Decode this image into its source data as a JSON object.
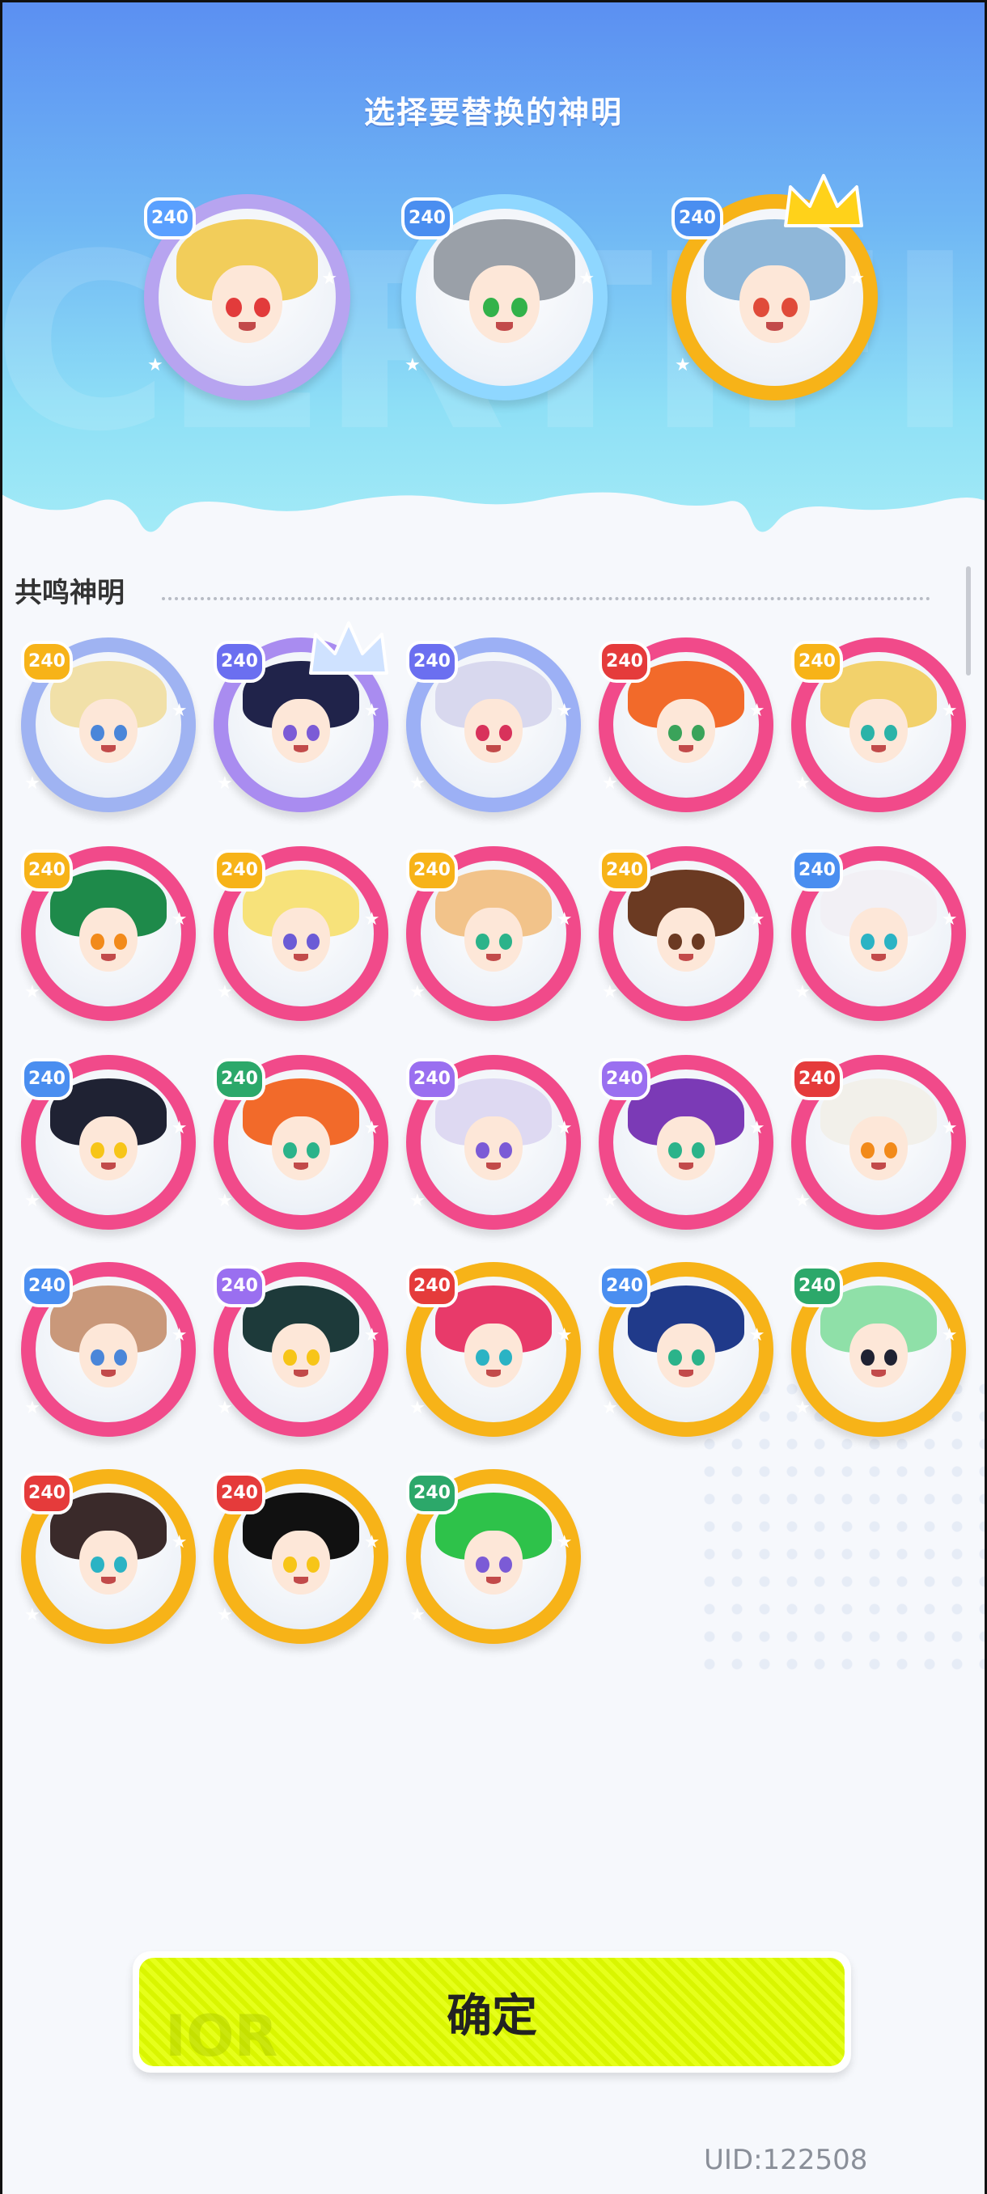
{
  "header": {
    "title": "选择要替换的神明",
    "bg_text": "CERTIFIE"
  },
  "selected": [
    {
      "level": "240",
      "ring": "#b7a4f0",
      "badge": "#5aa0ff",
      "hair": "#f2cd5a",
      "eye": "#e23b3b",
      "crown": false
    },
    {
      "level": "240",
      "ring": "#8fd7ff",
      "badge": "#4a8ef0",
      "hair": "#9aa0a8",
      "eye": "#32b24a",
      "crown": false
    },
    {
      "level": "240",
      "ring": "#f7b318",
      "badge": "#4a8ef0",
      "hair": "#8fb7d9",
      "eye": "#e04b3a",
      "crown": true
    }
  ],
  "section": {
    "label": "共鸣神明"
  },
  "gods": [
    {
      "level": "240",
      "ring": "#9fb3f2",
      "badge": "#f7b318",
      "hair": "#f1e0a8",
      "eye": "#4a86d9",
      "crown": false
    },
    {
      "level": "240",
      "ring": "#a98cf0",
      "badge": "#6b6ff0",
      "hair": "#20234a",
      "eye": "#7b5bd6",
      "crown": true
    },
    {
      "level": "240",
      "ring": "#9cb0f5",
      "badge": "#6b6ff0",
      "hair": "#d8d8ee",
      "eye": "#d8325b",
      "crown": false
    },
    {
      "level": "240",
      "ring": "#f14a8a",
      "badge": "#e53b3b",
      "hair": "#f26a2a",
      "eye": "#3aa35a",
      "crown": false
    },
    {
      "level": "240",
      "ring": "#f14a8a",
      "badge": "#f7b318",
      "hair": "#f2d16b",
      "eye": "#2bb3a8",
      "crown": false
    },
    {
      "level": "240",
      "ring": "#f14a8a",
      "badge": "#f7b318",
      "hair": "#1e8a4a",
      "eye": "#f28a1a",
      "crown": false
    },
    {
      "level": "240",
      "ring": "#f14a8a",
      "badge": "#f7b318",
      "hair": "#f7e27a",
      "eye": "#6b5bd6",
      "crown": false
    },
    {
      "level": "240",
      "ring": "#f14a8a",
      "badge": "#f7b318",
      "hair": "#f2c38a",
      "eye": "#2bb38a",
      "crown": false
    },
    {
      "level": "240",
      "ring": "#f14a8a",
      "badge": "#f7b318",
      "hair": "#6b3a22",
      "eye": "#6b3a22",
      "crown": false
    },
    {
      "level": "240",
      "ring": "#f14a8a",
      "badge": "#4a8ef0",
      "hair": "#f2f0f5",
      "eye": "#2bb3c4",
      "crown": false
    },
    {
      "level": "240",
      "ring": "#f14a8a",
      "badge": "#4a8ef0",
      "hair": "#1f2233",
      "eye": "#f7c518",
      "crown": false
    },
    {
      "level": "240",
      "ring": "#f14a8a",
      "badge": "#2ca86a",
      "hair": "#f26a2a",
      "eye": "#2bb38a",
      "crown": false
    },
    {
      "level": "240",
      "ring": "#f14a8a",
      "badge": "#9a6ff0",
      "hair": "#ded9f2",
      "eye": "#7b5bd6",
      "crown": false
    },
    {
      "level": "240",
      "ring": "#f14a8a",
      "badge": "#9a6ff0",
      "hair": "#7b3ab6",
      "eye": "#2bb38a",
      "crown": false
    },
    {
      "level": "240",
      "ring": "#f14a8a",
      "badge": "#e53b3b",
      "hair": "#f2f0ea",
      "eye": "#f28a1a",
      "crown": false
    },
    {
      "level": "240",
      "ring": "#f14a8a",
      "badge": "#4a8ef0",
      "hair": "#c9987a",
      "eye": "#4a86d9",
      "crown": false
    },
    {
      "level": "240",
      "ring": "#f14a8a",
      "badge": "#9a6ff0",
      "hair": "#1d3a3a",
      "eye": "#f7c518",
      "crown": false
    },
    {
      "level": "240",
      "ring": "#f7b318",
      "badge": "#e53b3b",
      "hair": "#e83a6a",
      "eye": "#2bb3c4",
      "crown": false
    },
    {
      "level": "240",
      "ring": "#f7b318",
      "badge": "#4a8ef0",
      "hair": "#203a8a",
      "eye": "#2bb38a",
      "crown": false
    },
    {
      "level": "240",
      "ring": "#f7b318",
      "badge": "#2ca86a",
      "hair": "#8fe0a8",
      "eye": "#1f2233",
      "crown": false
    },
    {
      "level": "240",
      "ring": "#f7b318",
      "badge": "#e53b3b",
      "hair": "#3a2a2a",
      "eye": "#2bb3c4",
      "crown": false
    },
    {
      "level": "240",
      "ring": "#f7b318",
      "badge": "#e53b3b",
      "hair": "#111111",
      "eye": "#f7c518",
      "crown": false
    },
    {
      "level": "240",
      "ring": "#f7b318",
      "badge": "#2ca86a",
      "hair": "#2ec24a",
      "eye": "#7b5bd6",
      "crown": false
    }
  ],
  "confirm": {
    "label": "确定",
    "watermark": "IOR"
  },
  "footer": {
    "uid": "UID:122508"
  }
}
